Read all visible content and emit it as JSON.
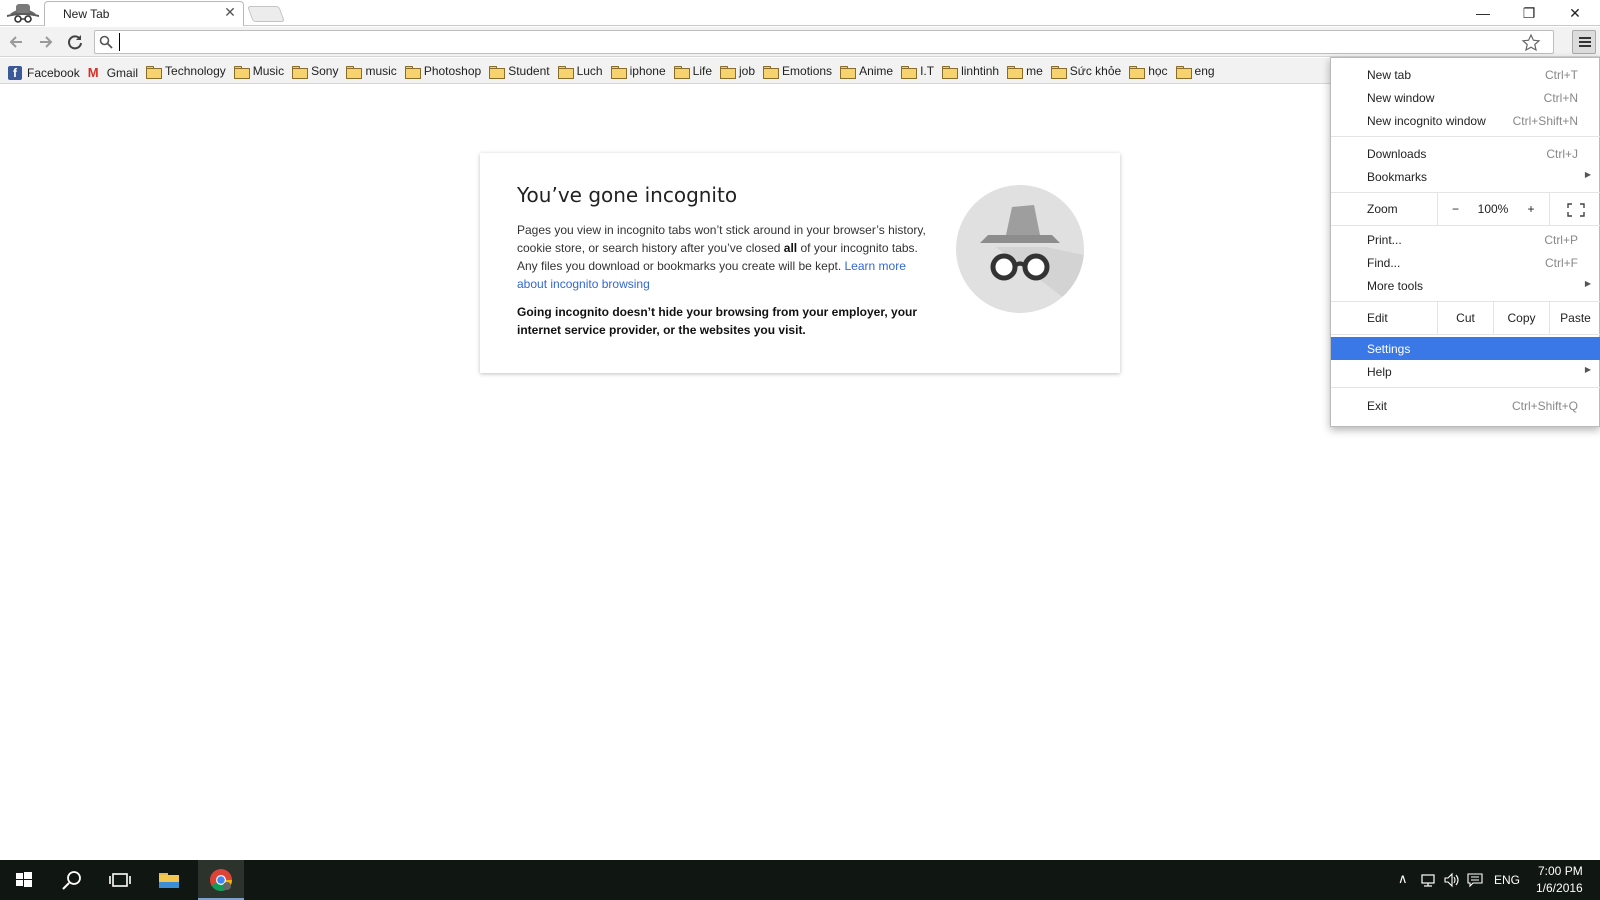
{
  "tab": {
    "title": "New Tab",
    "close": "✕"
  },
  "window_controls": {
    "minimize": "—",
    "restore": "❐",
    "close": "✕"
  },
  "omnibox": {
    "value": "",
    "placeholder": ""
  },
  "bookmarks": [
    {
      "label": "Facebook",
      "icon": "facebook-icon"
    },
    {
      "label": "Gmail",
      "icon": "gmail-icon"
    },
    {
      "label": "Technology",
      "icon": "folder-icon"
    },
    {
      "label": "Music",
      "icon": "folder-icon"
    },
    {
      "label": "Sony",
      "icon": "folder-icon"
    },
    {
      "label": "music",
      "icon": "folder-icon"
    },
    {
      "label": "Photoshop",
      "icon": "folder-icon"
    },
    {
      "label": "Student",
      "icon": "folder-icon"
    },
    {
      "label": "Luch",
      "icon": "folder-icon"
    },
    {
      "label": "iphone",
      "icon": "folder-icon"
    },
    {
      "label": "Life",
      "icon": "folder-icon"
    },
    {
      "label": "job",
      "icon": "folder-icon"
    },
    {
      "label": "Emotions",
      "icon": "folder-icon"
    },
    {
      "label": "Anime",
      "icon": "folder-icon"
    },
    {
      "label": "I.T",
      "icon": "folder-icon"
    },
    {
      "label": "linhtinh",
      "icon": "folder-icon"
    },
    {
      "label": "me",
      "icon": "folder-icon"
    },
    {
      "label": "Sức khỏe",
      "icon": "folder-icon"
    },
    {
      "label": "học",
      "icon": "folder-icon"
    },
    {
      "label": "eng",
      "icon": "folder-icon"
    }
  ],
  "card": {
    "title": "You’ve gone incognito",
    "p1_a": "Pages you view in incognito tabs won’t stick around in your browser’s history, cookie store, or search history after you’ve closed ",
    "p1_bold": "all",
    "p1_b": " of your incognito tabs. Any files you download or bookmarks you create will be kept. ",
    "p1_link": "Learn more about incognito browsing",
    "warning": "Going incognito doesn’t hide your browsing from your employer, your internet service provider, or the websites you visit."
  },
  "menu": {
    "new_tab": {
      "label": "New tab",
      "shortcut": "Ctrl+T"
    },
    "new_window": {
      "label": "New window",
      "shortcut": "Ctrl+N"
    },
    "new_incognito": {
      "label": "New incognito window",
      "shortcut": "Ctrl+Shift+N"
    },
    "downloads": {
      "label": "Downloads",
      "shortcut": "Ctrl+J"
    },
    "bookmarks": {
      "label": "Bookmarks"
    },
    "zoom": {
      "label": "Zoom",
      "minus": "−",
      "value": "100%",
      "plus": "+"
    },
    "print": {
      "label": "Print...",
      "shortcut": "Ctrl+P"
    },
    "find": {
      "label": "Find...",
      "shortcut": "Ctrl+F"
    },
    "more_tools": {
      "label": "More tools"
    },
    "edit": {
      "label": "Edit",
      "cut": "Cut",
      "copy": "Copy",
      "paste": "Paste"
    },
    "settings": {
      "label": "Settings"
    },
    "help": {
      "label": "Help"
    },
    "exit": {
      "label": "Exit",
      "shortcut": "Ctrl+Shift+Q"
    }
  },
  "taskbar": {
    "language": "ENG",
    "time": "7:00 PM",
    "date": "1/6/2016"
  },
  "colors": {
    "menu_highlight": "#3b78e7",
    "link": "#3367d6",
    "taskbar": "#101612"
  }
}
